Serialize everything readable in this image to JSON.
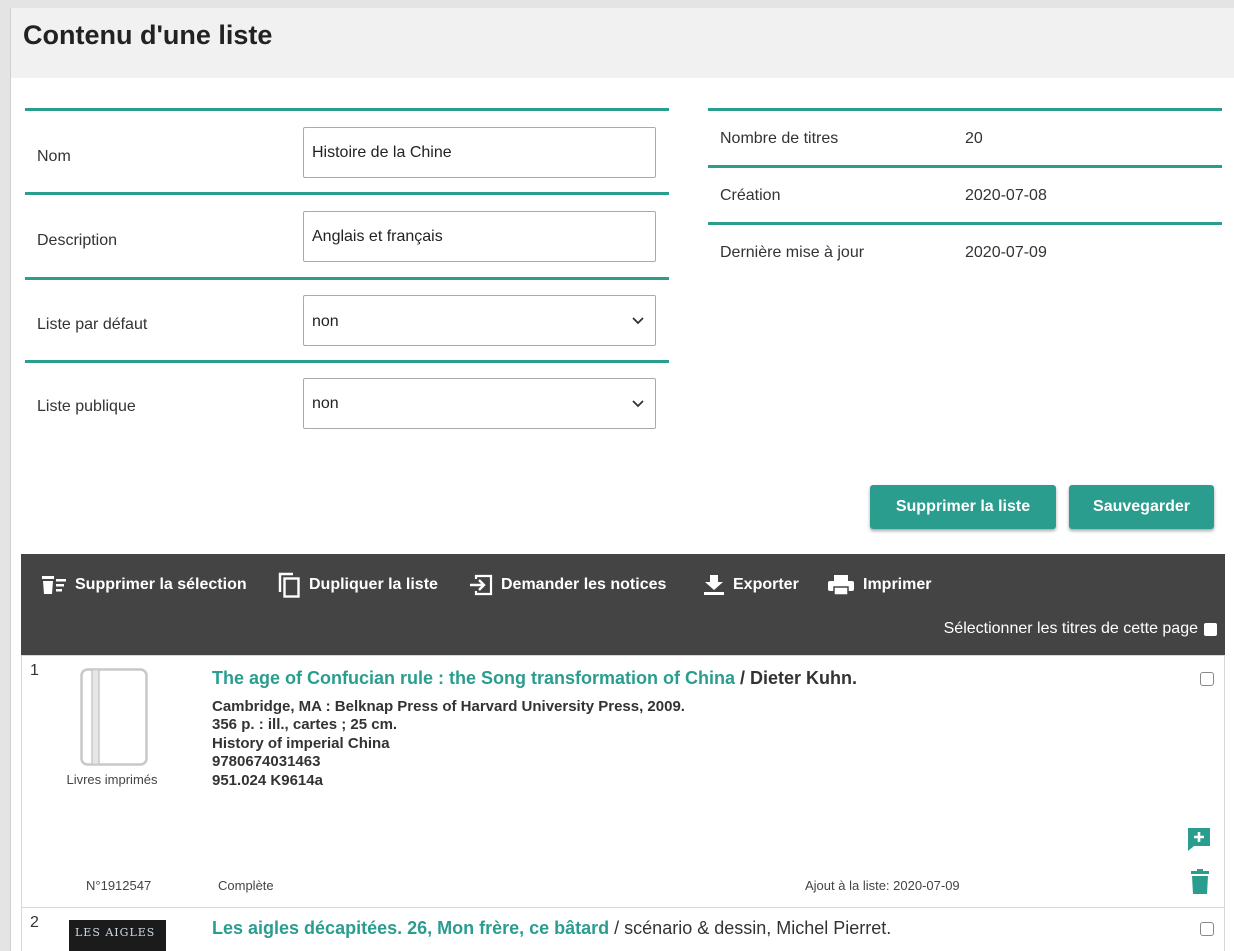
{
  "page": {
    "title": "Contenu d'une liste"
  },
  "form": {
    "nom_label": "Nom",
    "nom_value": "Histoire de la Chine",
    "description_label": "Description",
    "description_value": "Anglais et français",
    "defaut_label": "Liste par défaut",
    "defaut_value": "non",
    "publique_label": "Liste publique",
    "publique_value": "non"
  },
  "info": {
    "nb_titres_label": "Nombre de titres",
    "nb_titres_value": "20",
    "creation_label": "Création",
    "creation_value": "2020-07-08",
    "maj_label": "Dernière mise à jour",
    "maj_value": "2020-07-09"
  },
  "buttons": {
    "delete_list": "Supprimer la liste",
    "save": "Sauvegarder"
  },
  "toolbar": {
    "delete_selection": "Supprimer la sélection",
    "duplicate": "Dupliquer la liste",
    "request_records": "Demander les notices",
    "export": "Exporter",
    "print": "Imprimer",
    "select_page": "Sélectionner les titres de cette page"
  },
  "records": [
    {
      "number": "1",
      "title": "The age of Confucian rule : the Song transformation of China",
      "author": " / Dieter Kuhn.",
      "lines": [
        "Cambridge, MA : Belknap Press of Harvard University Press, 2009.",
        "356 p. : ill., cartes ; 25 cm.",
        "History of imperial China",
        "9780674031463",
        "951.024 K9614a"
      ],
      "doc_type": "Livres imprimés",
      "record_no": "N°1912547",
      "status": "Complète",
      "added": "Ajout à la liste: 2020-07-09",
      "icons": [
        "book-icon",
        "add-comment-icon",
        "trash-icon"
      ]
    },
    {
      "number": "2",
      "title": "Les aigles décapitées. 26, Mon frère, ce bâtard",
      "author": " / scénario & dessin, Michel Pierret.",
      "cover_text": "LES AIGLES"
    }
  ],
  "colors": {
    "accent": "#2a9d8f",
    "toolbar_bg": "#444444",
    "title_bg": "#f1f1f1"
  }
}
